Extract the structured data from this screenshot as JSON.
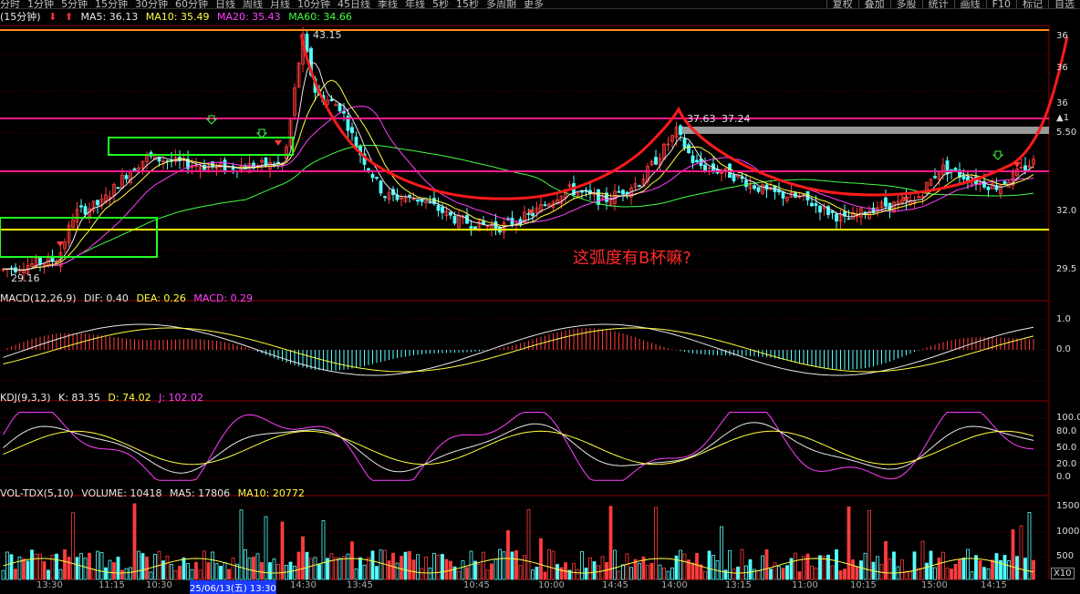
{
  "toolbar": {
    "periods": [
      "分时",
      "1分钟",
      "5分钟",
      "15分钟",
      "30分钟",
      "60分钟",
      "日线",
      "周线",
      "月线",
      "10分钟",
      "45日线",
      "季线",
      "年线",
      "5秒",
      "15秒",
      "多周期",
      "更多"
    ],
    "right": [
      "复权",
      "叠加",
      "多股",
      "统计",
      "画线",
      "F10",
      "标记",
      "自选"
    ]
  },
  "main_panel": {
    "title": "(15分钟)",
    "ma": [
      {
        "label": "MA5: 36.13",
        "color": "#e8e8e8"
      },
      {
        "label": "MA10: 35.49",
        "color": "#ffff40"
      },
      {
        "label": "MA20: 35.43",
        "color": "#ff40ff"
      },
      {
        "label": "MA60: 34.66",
        "color": "#40ff40"
      }
    ],
    "high_label": "43.15",
    "low_label": "29.16",
    "price_marks": [
      "37.63",
      "37.24"
    ],
    "annotation": "这弧度有B杯嘛?",
    "y_ticks": [
      "36",
      "36",
      "36",
      "▲1",
      "5.50",
      "32.0",
      "29.5"
    ]
  },
  "macd_panel": {
    "title": "MACD(12,26,9)",
    "values": [
      {
        "label": "DIF: 0.40",
        "color": "#e8e8e8"
      },
      {
        "label": "DEA: 0.26",
        "color": "#ffff40"
      },
      {
        "label": "MACD: 0.29",
        "color": "#ff40ff"
      }
    ],
    "y_ticks": [
      "1.0",
      "0.0"
    ]
  },
  "kdj_panel": {
    "title": "KDJ(9,3,3)",
    "values": [
      {
        "label": "K: 83.35",
        "color": "#e8e8e8"
      },
      {
        "label": "D: 74.02",
        "color": "#ffff40"
      },
      {
        "label": "J: 102.02",
        "color": "#ff40ff"
      }
    ],
    "y_ticks": [
      "100.0",
      "80.0",
      "50.0",
      "20.0",
      "0.0"
    ]
  },
  "vol_panel": {
    "title": "VOL-TDX(5,10)",
    "values": [
      {
        "label": "VOLUME: 10418",
        "color": "#e8e8e8"
      },
      {
        "label": "MA5: 17806",
        "color": "#e8e8e8"
      },
      {
        "label": "MA10: 20772",
        "color": "#ffff40"
      }
    ],
    "y_ticks": [
      "1500",
      "1000",
      "500"
    ],
    "unit": "X10"
  },
  "time_axis": [
    "13:30",
    "11:15",
    "10:30",
    "25/06/13(五) 13:30",
    "14:30",
    "13:45",
    "10:45",
    "10:00",
    "14:45",
    "14:00",
    "13:15",
    "11:00",
    "10:15",
    "15:00",
    "14:15"
  ],
  "colors": {
    "up": "#ff3c3c",
    "down": "#54ffff",
    "ma5": "#e8e8e8",
    "ma10": "#ffff40",
    "ma20": "#ff40ff",
    "ma60": "#40ff40",
    "level": "#ff1a8c",
    "yellow": "#ffff00",
    "box": "#22ff22",
    "curve": "#ff1a1a"
  }
}
